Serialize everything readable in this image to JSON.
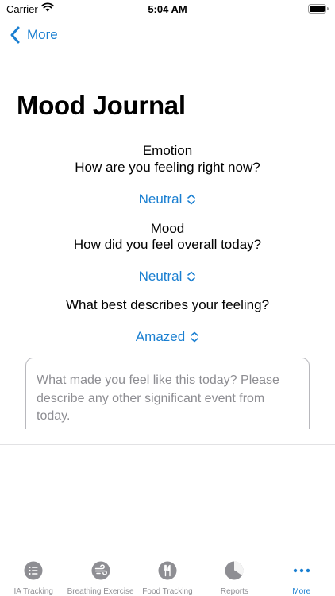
{
  "status_bar": {
    "carrier": "Carrier",
    "time": "5:04 AM"
  },
  "nav": {
    "back_label": "More"
  },
  "page_title": "Mood Journal",
  "questions": [
    {
      "title": "Emotion",
      "subtitle": "How are you feeling right now?",
      "selected": "Neutral"
    },
    {
      "title": "Mood",
      "subtitle": "How did you feel overall today?",
      "selected": "Neutral"
    },
    {
      "title": "",
      "subtitle": "What best describes your feeling?",
      "selected": "Amazed"
    }
  ],
  "notes": {
    "placeholder": "What made you feel like this today? Please describe any other significant event from today."
  },
  "tabs": [
    {
      "label": "IA Tracking",
      "icon": "list-icon"
    },
    {
      "label": "Breathing Exercise",
      "icon": "wind-icon"
    },
    {
      "label": "Food Tracking",
      "icon": "fork-knife-icon"
    },
    {
      "label": "Reports",
      "icon": "pie-chart-icon"
    },
    {
      "label": "More",
      "icon": "more-icon"
    }
  ],
  "colors": {
    "accent": "#1a7fd1",
    "inactive": "#8e8e93"
  }
}
